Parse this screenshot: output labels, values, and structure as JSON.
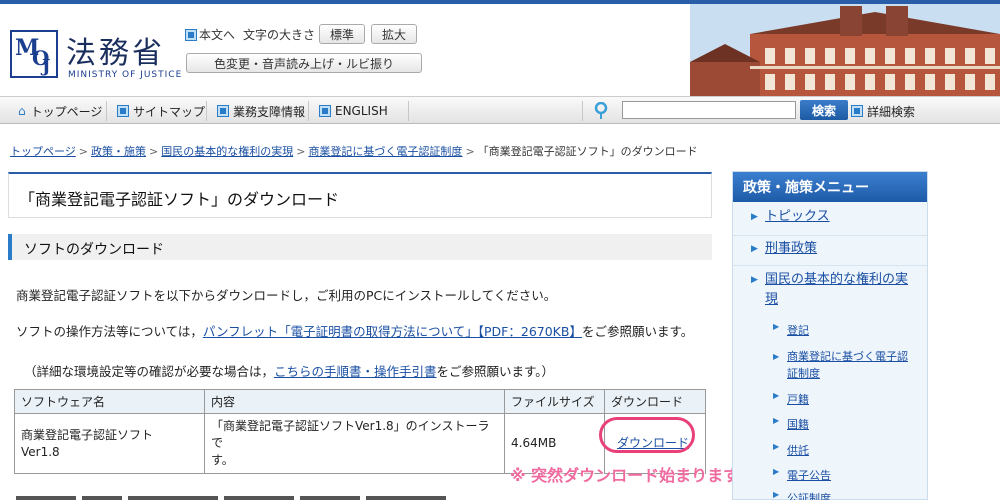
{
  "header": {
    "logo_initials_1": "M",
    "logo_initials_2": "O",
    "logo_initials_3": "J",
    "title": "法務省",
    "subtitle": "MINISTRY OF JUSTICE",
    "skip_link": "本文へ",
    "font_size_label": "文字の大きさ",
    "font_standard": "標準",
    "font_large": "拡大",
    "accessibility_button": "色変更・音声読み上げ・ルビ振り"
  },
  "nav": {
    "items": [
      "トップページ",
      "サイトマップ",
      "業務支障情報",
      "ENGLISH"
    ],
    "search_button": "検索",
    "advanced_search": "詳細検索"
  },
  "breadcrumb": {
    "items": [
      "トップページ",
      "政策・施策",
      "国民の基本的な権利の実現",
      "商業登記に基づく電子認証制度"
    ],
    "current": "「商業登記電子認証ソフト」のダウンロード",
    "separator": ">"
  },
  "main": {
    "page_title": "「商業登記電子認証ソフト」のダウンロード",
    "section_title": "ソフトのダウンロード",
    "para1": "商業登記電子認証ソフトを以下からダウンロードし，ご利用のPCにインストールしてください。",
    "para2_pre": "ソフトの操作方法等については，",
    "para2_link": "パンフレット「電子証明書の取得方法について」【PDF：2670KB】",
    "para2_post": "をご参照願います。",
    "para3_pre": "（詳細な環境設定等の確認が必要な場合は，",
    "para3_link": "こちらの手順書・操作手引書",
    "para3_post": "をご参照願います。）",
    "table": {
      "headers": [
        "ソフトウェア名",
        "内容",
        "ファイルサイズ",
        "ダウンロード"
      ],
      "row": {
        "name_line1": "商業登記電子認証ソフト",
        "name_line2": "Ver1.8",
        "content_line1": "「商業登記電子認証ソフトVer1.8」のインストーラで",
        "content_line2": "す。",
        "size": "4.64MB",
        "download": "ダウンロード"
      }
    },
    "notice": "※ 突然ダウンロード始まります！"
  },
  "sidebar": {
    "title": "政策・施策メニュー",
    "level1": [
      "トピックス",
      "刑事政策"
    ],
    "level1_expanded_line1": "国民の基本的な権利の実",
    "level1_expanded_line2": "現",
    "level2": [
      "登記",
      "商業登記に基づく電子認",
      "証制度",
      "戸籍",
      "国籍",
      "供託",
      "電子公告",
      "公証制度"
    ]
  },
  "colors": {
    "brand": "#1b3f8f",
    "accent": "#2a7bc8",
    "highlight": "#e8417a",
    "notice": "#f06aa0"
  }
}
